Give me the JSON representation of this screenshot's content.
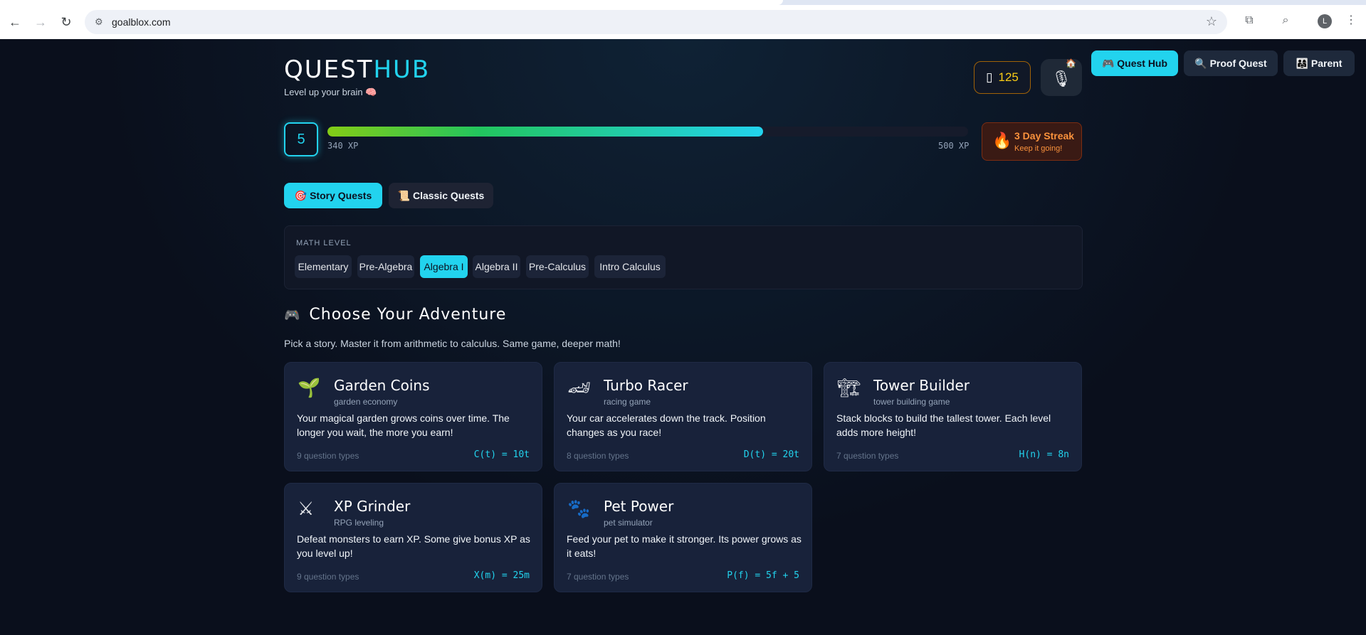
{
  "browser": {
    "url": "goalblox.com",
    "profile_initial": "L"
  },
  "header": {
    "logo_part1": "QUEST",
    "logo_part2": "HUB",
    "tagline": "Level up your brain 🧠",
    "coins_icon": "▯",
    "coins": "125",
    "mic_icon": "🎙",
    "home_icon": "🏠",
    "nav": {
      "quest_hub": "🎮 Quest Hub",
      "proof_quest": "🔍 Proof Quest",
      "parent": "👨‍👩‍👧 Parent"
    }
  },
  "progress": {
    "level": "5",
    "xp_current": "340 XP",
    "xp_max": "500 XP",
    "xp_fraction": 0.68
  },
  "streak": {
    "icon": "🔥",
    "title": "3 Day Streak",
    "subtitle": "Keep it going!"
  },
  "mode_tabs": {
    "story": "🎯 Story Quests",
    "classic": "📜 Classic Quests"
  },
  "math_level": {
    "label": "MATH LEVEL",
    "options": [
      "Elementary",
      "Pre-Algebra",
      "Algebra I",
      "Algebra II",
      "Pre-Calculus",
      "Intro Calculus"
    ],
    "selected": "Algebra I"
  },
  "adventure": {
    "icon": "🎮",
    "title": "Choose Your Adventure",
    "subtitle": "Pick a story. Master it from arithmetic to calculus. Same game, deeper math!"
  },
  "cards": [
    {
      "icon": "🌱",
      "title": "Garden Coins",
      "type": "garden economy",
      "desc": "Your magical garden grows coins over time. The longer you wait, the more you earn!",
      "count": "9 question types",
      "formula": "C(t) = 10t"
    },
    {
      "icon": "🏎",
      "title": "Turbo Racer",
      "type": "racing game",
      "desc": "Your car accelerates down the track. Position changes as you race!",
      "count": "8 question types",
      "formula": "D(t) = 20t"
    },
    {
      "icon": "🏗",
      "title": "Tower Builder",
      "type": "tower building game",
      "desc": "Stack blocks to build the tallest tower. Each level adds more height!",
      "count": "7 question types",
      "formula": "H(n) = 8n"
    },
    {
      "icon": "⚔",
      "title": "XP Grinder",
      "type": "RPG leveling",
      "desc": "Defeat monsters to earn XP. Some give bonus XP as you level up!",
      "count": "9 question types",
      "formula": "X(m) = 25m"
    },
    {
      "icon": "🐾",
      "title": "Pet Power",
      "type": "pet simulator",
      "desc": "Feed your pet to make it stronger. Its power grows as it eats!",
      "count": "7 question types",
      "formula": "P(f) = 5f + 5"
    }
  ]
}
